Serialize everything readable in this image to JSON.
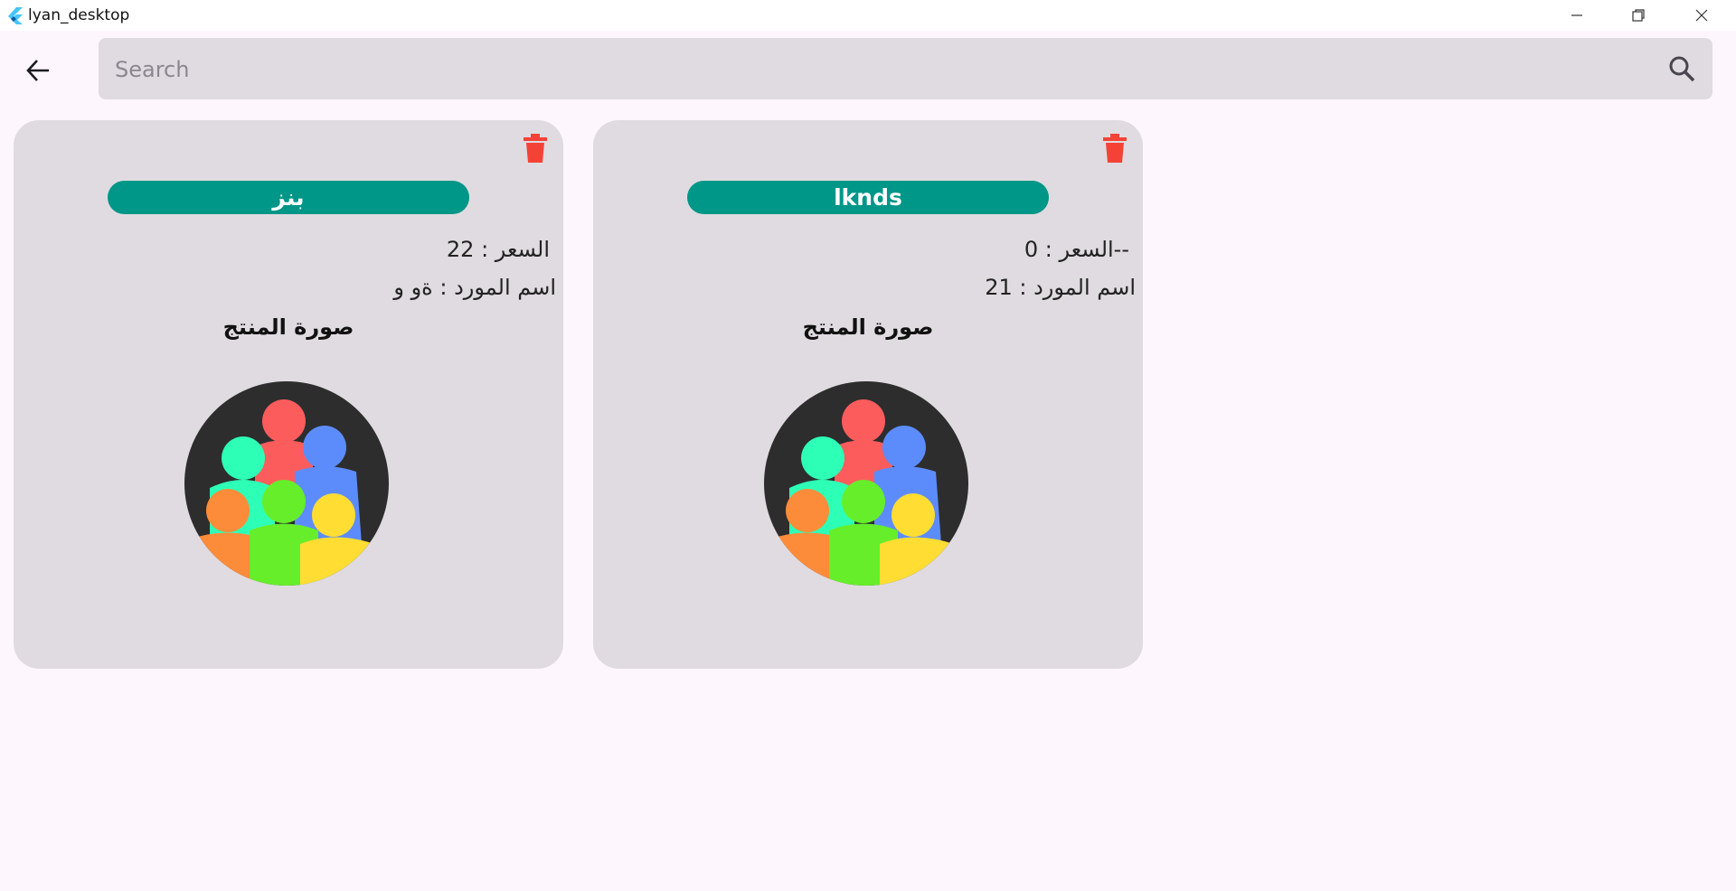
{
  "window": {
    "title": "lyan_desktop"
  },
  "search": {
    "placeholder": "Search"
  },
  "products": [
    {
      "name": "بنز",
      "price_line": "السعر : 22",
      "supplier_line": "اسم المورد : ةو و",
      "image_label": "صورة المنتج"
    },
    {
      "name": "lknds",
      "price_line": "--السعر : 0",
      "supplier_line": "اسم المورد : 21",
      "image_label": "صورة المنتج"
    }
  ],
  "colors": {
    "badge": "#009688",
    "delete": "#f44336",
    "card": "#e0dbe0",
    "background": "#fdf7fd"
  },
  "icons": {
    "back": "arrow-back-icon",
    "search": "search-icon",
    "delete": "trash-icon",
    "avatar": "group-people-icon"
  }
}
